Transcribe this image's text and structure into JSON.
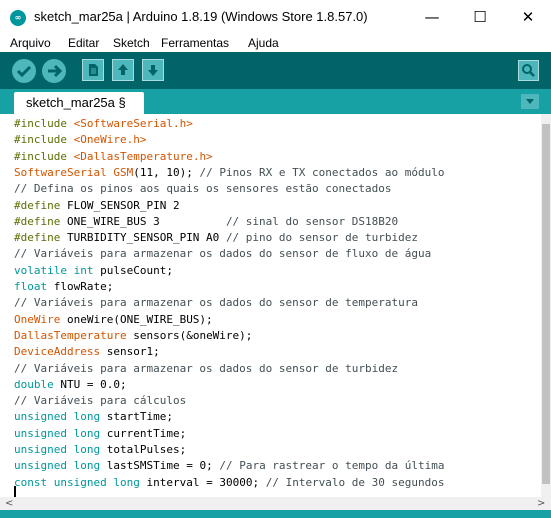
{
  "window": {
    "title": "sketch_mar25a | Arduino 1.8.19 (Windows Store 1.8.57.0)",
    "app_icon_text": "∞",
    "minimize": "—",
    "maximize": "☐",
    "close": "✕"
  },
  "menu": [
    "Arquivo",
    "Editar",
    "Sketch",
    "Ferramentas",
    "Ajuda"
  ],
  "toolbar": {
    "buttons": [
      "verify-icon",
      "upload-icon",
      "new-icon",
      "open-icon",
      "save-icon",
      "serial-monitor-icon"
    ]
  },
  "tab": {
    "label": "sketch_mar25a §"
  },
  "code": [
    [
      [
        "#include",
        "dir"
      ],
      [
        " ",
        ""
      ],
      [
        "<SoftwareSerial.h>",
        "hdr"
      ]
    ],
    [
      [
        "#include",
        "dir"
      ],
      [
        " ",
        ""
      ],
      [
        "<OneWire.h>",
        "hdr"
      ]
    ],
    [
      [
        "#include",
        "dir"
      ],
      [
        " ",
        ""
      ],
      [
        "<DallasTemperature.h>",
        "hdr"
      ]
    ],
    [
      [
        "SoftwareSerial",
        "type"
      ],
      [
        " ",
        ""
      ],
      [
        "GSM",
        "type"
      ],
      [
        "(11, 10); ",
        ""
      ],
      [
        "// Pinos RX e TX conectados ao módulo",
        "cm"
      ]
    ],
    [
      [
        "// Defina os pinos aos quais os sensores estão conectados",
        "cm"
      ]
    ],
    [
      [
        "#define",
        "dir"
      ],
      [
        " FLOW_SENSOR_PIN 2",
        ""
      ]
    ],
    [
      [
        "#define",
        "dir"
      ],
      [
        " ONE_WIRE_BUS 3          ",
        ""
      ],
      [
        "// sinal do sensor DS18B20",
        "cm"
      ]
    ],
    [
      [
        "#define",
        "dir"
      ],
      [
        " TURBIDITY_SENSOR_PIN A0 ",
        ""
      ],
      [
        "// pino do sensor de turbidez",
        "cm"
      ]
    ],
    [
      [
        "// Variáveis para armazenar os dados do sensor de fluxo de água",
        "cm"
      ]
    ],
    [
      [
        "volatile",
        "kw"
      ],
      [
        " ",
        ""
      ],
      [
        "int",
        "kw"
      ],
      [
        " pulseCount;",
        ""
      ]
    ],
    [
      [
        "float",
        "kw"
      ],
      [
        " flowRate;",
        ""
      ]
    ],
    [
      [
        "// Variáveis para armazenar os dados do sensor de temperatura",
        "cm"
      ]
    ],
    [
      [
        "OneWire",
        "type"
      ],
      [
        " oneWire(ONE_WIRE_BUS);",
        ""
      ]
    ],
    [
      [
        "DallasTemperature",
        "type"
      ],
      [
        " sensors(&oneWire);",
        ""
      ]
    ],
    [
      [
        "DeviceAddress",
        "type"
      ],
      [
        " sensor1;",
        ""
      ]
    ],
    [
      [
        "// Variáveis para armazenar os dados do sensor de turbidez",
        "cm"
      ]
    ],
    [
      [
        "double",
        "kw"
      ],
      [
        " NTU = 0.0;",
        ""
      ]
    ],
    [
      [
        "// Variáveis para cálculos",
        "cm"
      ]
    ],
    [
      [
        "unsigned",
        "kw"
      ],
      [
        " ",
        ""
      ],
      [
        "long",
        "kw"
      ],
      [
        " startTime;",
        ""
      ]
    ],
    [
      [
        "unsigned",
        "kw"
      ],
      [
        " ",
        ""
      ],
      [
        "long",
        "kw"
      ],
      [
        " currentTime;",
        ""
      ]
    ],
    [
      [
        "unsigned",
        "kw"
      ],
      [
        " ",
        ""
      ],
      [
        "long",
        "kw"
      ],
      [
        " totalPulses;",
        ""
      ]
    ],
    [
      [
        "unsigned",
        "kw"
      ],
      [
        " ",
        ""
      ],
      [
        "long",
        "kw"
      ],
      [
        " lastSMSTime = 0; ",
        ""
      ],
      [
        "// Para rastrear o tempo da última",
        "cm"
      ]
    ],
    [
      [
        "const",
        "kw"
      ],
      [
        " ",
        ""
      ],
      [
        "unsigned",
        "kw"
      ],
      [
        " ",
        ""
      ],
      [
        "long",
        "kw"
      ],
      [
        " interval = 30000; ",
        ""
      ],
      [
        "// Intervalo de 30 segundos",
        "cm"
      ]
    ]
  ],
  "scroll": {
    "left_arrow": "<",
    "right_arrow": ">"
  },
  "colors": {
    "toolbar": "#006468",
    "tabbar": "#17a1a5",
    "button": "#4db7bb",
    "directive": "#5e6d03",
    "header": "#d35400",
    "keyword": "#00979c",
    "comment": "#434f54"
  }
}
